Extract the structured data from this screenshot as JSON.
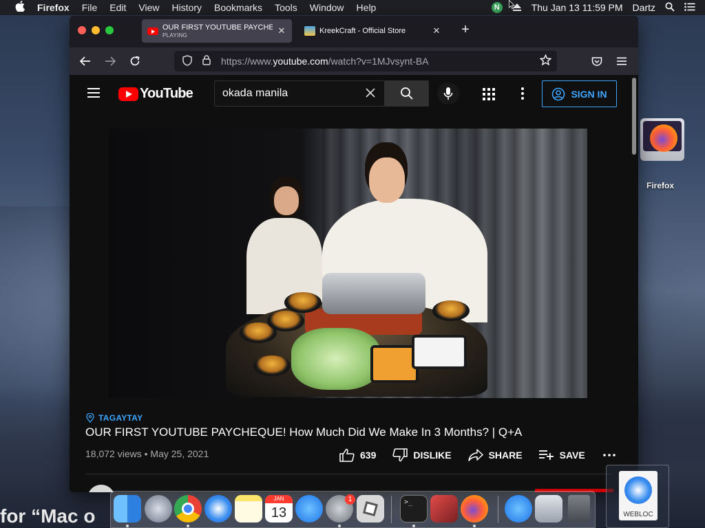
{
  "menubar": {
    "app_name": "Firefox",
    "menus": [
      "File",
      "Edit",
      "View",
      "History",
      "Bookmarks",
      "Tools",
      "Window",
      "Help"
    ],
    "badge_letter": "N",
    "clock": "Thu Jan 13  11:59 PM",
    "user": "Dartz"
  },
  "browser": {
    "tabs": [
      {
        "title": "OUR FIRST YOUTUBE PAYCHEQ",
        "subtitle": "PLAYING",
        "active": true
      },
      {
        "title": "KreekCraft - Official Store",
        "subtitle": "",
        "active": false
      }
    ],
    "url_prefix": "https://www.",
    "url_domain": "youtube.com",
    "url_path": "/watch?v=1MJvsynt-BA"
  },
  "youtube": {
    "logo_text": "YouTube",
    "search_query": "okada manila",
    "sign_in_label": "SIGN IN",
    "video": {
      "location_tag": "TAGAYTAY",
      "title": "OUR FIRST YOUTUBE PAYCHEQUE! How Much Did We Make In 3 Months? | Q+A",
      "views": "18,072 views",
      "date": "May 25, 2021",
      "likes": "639",
      "dislike_label": "DISLIKE",
      "share_label": "SHARE",
      "save_label": "SAVE"
    }
  },
  "desktop": {
    "firefox_label": "Firefox",
    "background_text": "for “Mac o",
    "webloc_label": "WEBLOC"
  },
  "dock": {
    "settings_badge": "1",
    "calendar_month": "JAN",
    "calendar_day": "13"
  }
}
